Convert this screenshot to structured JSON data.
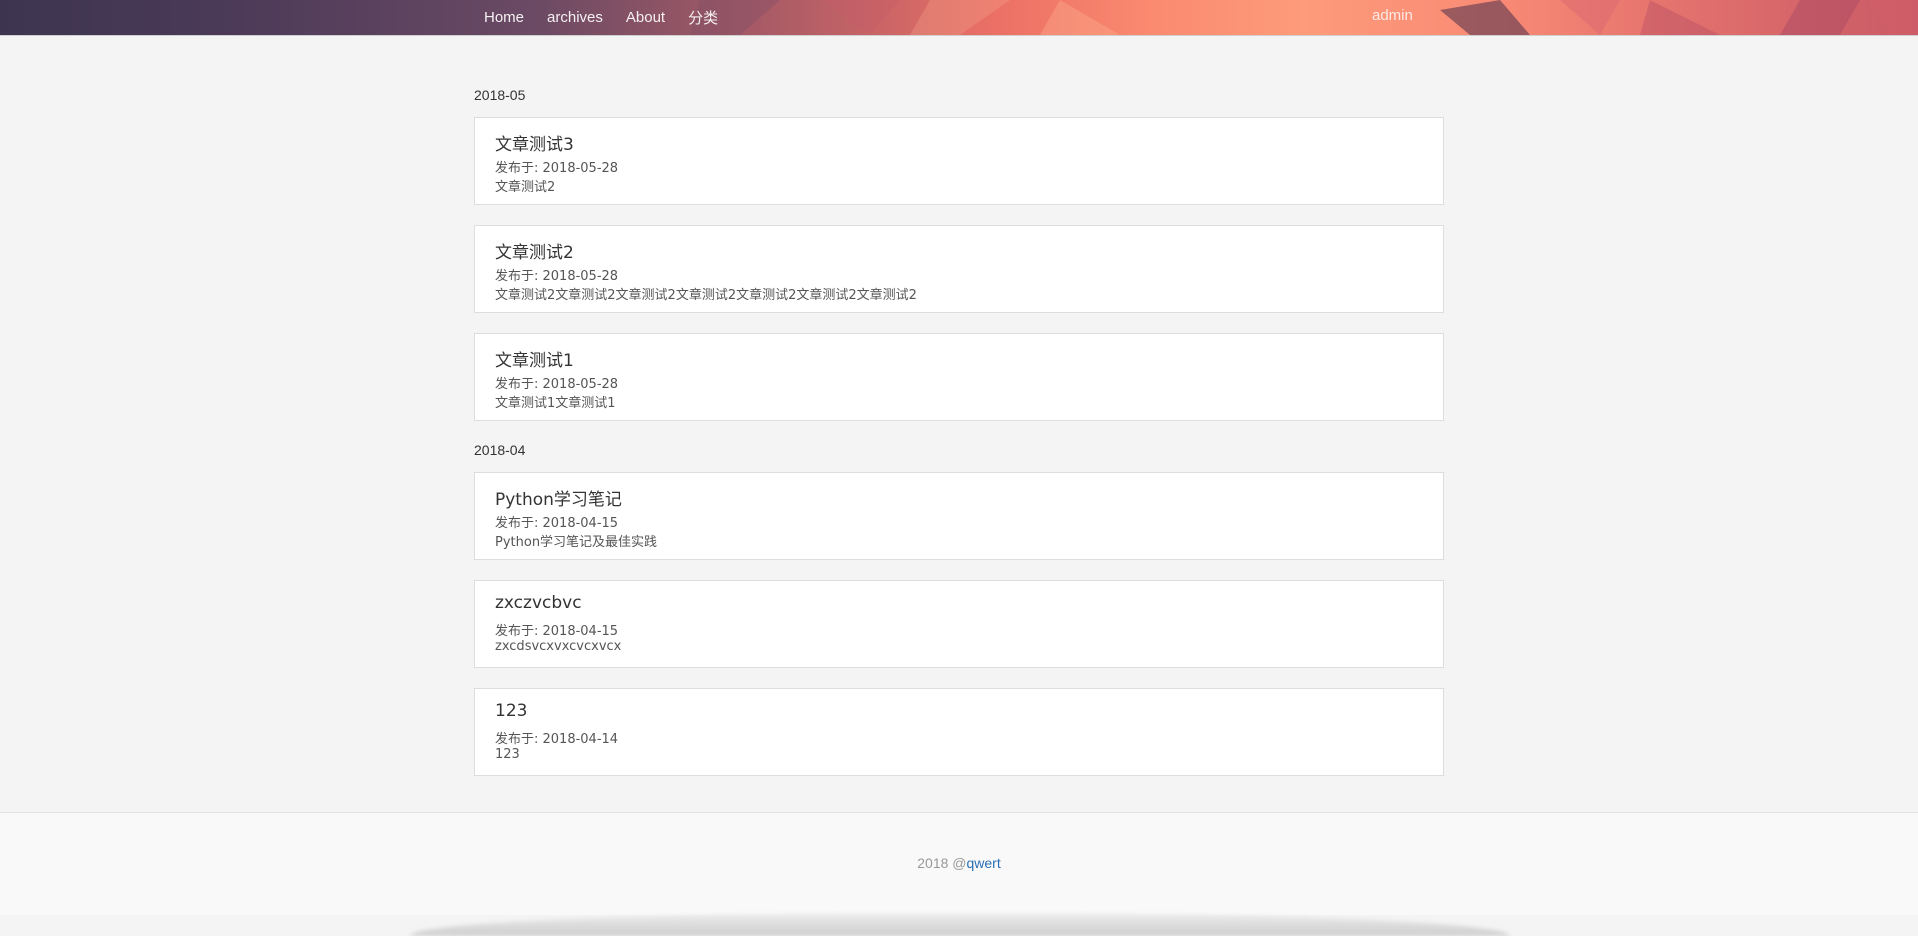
{
  "nav": {
    "links": [
      "Home",
      "archives",
      "About",
      "分类"
    ],
    "user": "admin"
  },
  "archives": [
    {
      "month": "2018-05",
      "posts": [
        {
          "title": "文章测试3",
          "date": "发布于: 2018-05-28",
          "excerpt": "文章测试2"
        },
        {
          "title": "文章测试2",
          "date": "发布于: 2018-05-28",
          "excerpt": "文章测试2文章测试2文章测试2文章测试2文章测试2文章测试2文章测试2"
        },
        {
          "title": "文章测试1",
          "date": "发布于: 2018-05-28",
          "excerpt": "文章测试1文章测试1"
        }
      ]
    },
    {
      "month": "2018-04",
      "posts": [
        {
          "title": "Python学习笔记",
          "date": "发布于: 2018-04-15",
          "excerpt": "Python学习笔记及最佳实践"
        },
        {
          "title": "zxczvcbvc",
          "date": "发布于: 2018-04-15",
          "excerpt": "zxcdsvcxvxcvcxvcx"
        },
        {
          "title": "123",
          "date": "发布于: 2018-04-14",
          "excerpt": "123"
        }
      ]
    }
  ],
  "footer": {
    "prefix": "2018 @",
    "link": "qwert"
  },
  "colors": {
    "accent_link": "#2a6fb5",
    "background": "#f4f4f4"
  }
}
